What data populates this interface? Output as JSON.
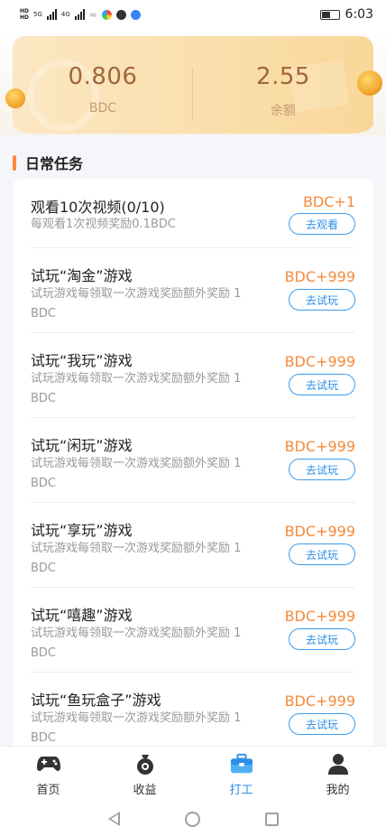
{
  "status_bar": {
    "time": "6:03",
    "hd_top": "HD",
    "hd_bottom": "HD",
    "net_1": "5G",
    "net_2": "4G"
  },
  "balance": {
    "bdc_value": "0.806",
    "bdc_label": "BDC",
    "balance_value": "2.55",
    "balance_label": "余额"
  },
  "section": {
    "title": "日常任务"
  },
  "tasks": [
    {
      "title": "观看10次视频(0/10)",
      "desc": "每观看1次视频奖励0.1BDC",
      "reward": "BDC+1",
      "button": "去观看"
    },
    {
      "title": "试玩“淘金”游戏",
      "desc": "试玩游戏每领取一次游戏奖励额外奖励 1 BDC",
      "reward": "BDC+999",
      "button": "去试玩"
    },
    {
      "title": "试玩“我玩”游戏",
      "desc": "试玩游戏每领取一次游戏奖励额外奖励 1 BDC",
      "reward": "BDC+999",
      "button": "去试玩"
    },
    {
      "title": "试玩“闲玩”游戏",
      "desc": "试玩游戏每领取一次游戏奖励额外奖励 1 BDC",
      "reward": "BDC+999",
      "button": "去试玩"
    },
    {
      "title": "试玩“享玩”游戏",
      "desc": "试玩游戏每领取一次游戏奖励额外奖励 1 BDC",
      "reward": "BDC+999",
      "button": "去试玩"
    },
    {
      "title": "试玩“嘻趣”游戏",
      "desc": "试玩游戏每领取一次游戏奖励额外奖励 1 BDC",
      "reward": "BDC+999",
      "button": "去试玩"
    },
    {
      "title": "试玩“鱼玩盒子”游戏",
      "desc": "试玩游戏每领取一次游戏奖励额外奖励 1 BDC",
      "reward": "BDC+999",
      "button": "去试玩"
    }
  ],
  "nav": {
    "items": [
      {
        "label": "首页",
        "icon": "gamepad-icon"
      },
      {
        "label": "收益",
        "icon": "money-bag-icon"
      },
      {
        "label": "打工",
        "icon": "briefcase-icon"
      },
      {
        "label": "我的",
        "icon": "user-icon"
      }
    ],
    "active_index": 2,
    "active_color": "#2c8de4"
  },
  "colors": {
    "accent_orange": "#f58a3a",
    "accent_blue": "#2c8de4",
    "card_gold": "#fbe0b0"
  }
}
